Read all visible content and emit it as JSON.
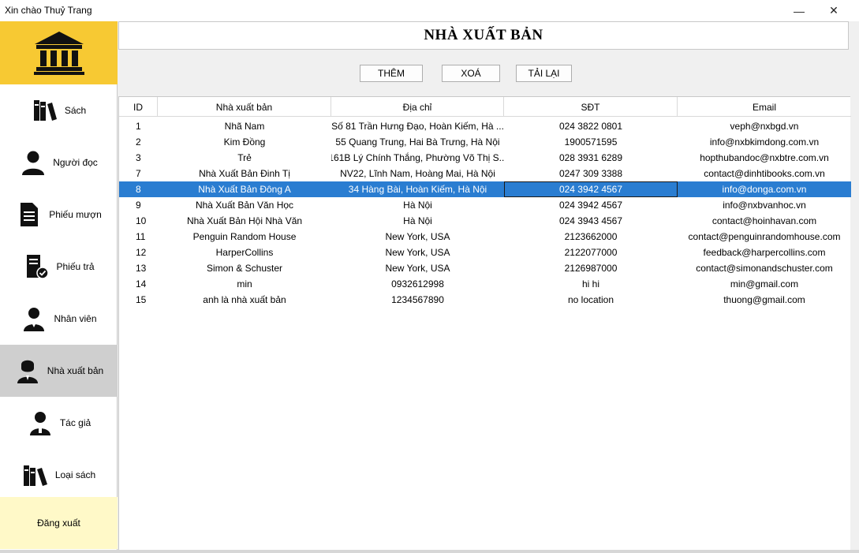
{
  "window": {
    "title": "Xin chào Thuỷ Trang",
    "minimize": "—",
    "close": "✕"
  },
  "sidebar": {
    "logo": "bank-icon",
    "items": [
      {
        "label": "Sách",
        "icon": "books-icon"
      },
      {
        "label": "Người đọc",
        "icon": "user-icon"
      },
      {
        "label": "Phiếu mượn",
        "icon": "document-icon"
      },
      {
        "label": "Phiếu trả",
        "icon": "receipt-check-icon"
      },
      {
        "label": "Nhân viên",
        "icon": "employee-icon"
      },
      {
        "label": "Nhà xuất bản",
        "icon": "publisher-icon",
        "active": true
      },
      {
        "label": "Tác giả",
        "icon": "author-icon"
      },
      {
        "label": "Loại sách",
        "icon": "book-category-icon"
      }
    ],
    "logout": "Đăng xuất"
  },
  "header": {
    "title": "NHÀ XUẤT BẢN"
  },
  "toolbar": {
    "add_label": "THÊM",
    "delete_label": "XOÁ",
    "reload_label": "TẢI LẠI"
  },
  "table": {
    "columns": [
      "ID",
      "Nhà xuất bản",
      "Địa chỉ",
      "SĐT",
      "Email"
    ],
    "rows": [
      [
        "1",
        "Nhã Nam",
        "Số 81 Trần Hưng Đạo, Hoàn Kiếm, Hà ...",
        "024 3822 0801",
        "veph@nxbgd.vn"
      ],
      [
        "2",
        "Kim Đồng",
        "55 Quang Trung, Hai Bà Trưng, Hà Nội",
        "1900571595",
        "info@nxbkimdong.com.vn"
      ],
      [
        "3",
        "Trẻ",
        "161B Lý Chính Thắng, Phường Võ Thị S...",
        "028 3931 6289",
        "hopthubandoc@nxbtre.com.vn"
      ],
      [
        "7",
        "Nhà Xuất Bản Đinh Tị",
        "NV22, Lĩnh Nam, Hoàng Mai, Hà Nội",
        "0247 309 3388",
        "contact@dinhtibooks.com.vn"
      ],
      [
        "8",
        "Nhà Xuất Bản Đông A",
        "34 Hàng Bài, Hoàn Kiếm, Hà Nội",
        "024 3942 4567",
        "info@donga.com.vn"
      ],
      [
        "9",
        "Nhà Xuất Bản Văn Học",
        "Hà Nội",
        "024 3942 4567",
        "info@nxbvanhoc.vn"
      ],
      [
        "10",
        "Nhà Xuất Bản Hội Nhà Văn",
        "Hà Nội",
        "024 3943 4567",
        "contact@hoinhavan.com"
      ],
      [
        "11",
        "Penguin Random House",
        "New York, USA",
        "2123662000",
        "contact@penguinrandomhouse.com"
      ],
      [
        "12",
        "HarperCollins",
        "New York, USA",
        "2122077000",
        "feedback@harpercollins.com"
      ],
      [
        "13",
        "Simon & Schuster",
        "New York, USA",
        "2126987000",
        "contact@simonandschuster.com"
      ],
      [
        "14",
        "min",
        "0932612998",
        "hi hi",
        "min@gmail.com"
      ],
      [
        "15",
        "anh là nhà xuất bản",
        "1234567890",
        "no location",
        "thuong@gmail.com"
      ]
    ],
    "selected_row_index": 4,
    "colors": {
      "selection": "#2a7dd1",
      "logo_bg": "#f7c933",
      "logout_bg": "#fff9c8",
      "active_nav": "#cfcfcf"
    }
  }
}
